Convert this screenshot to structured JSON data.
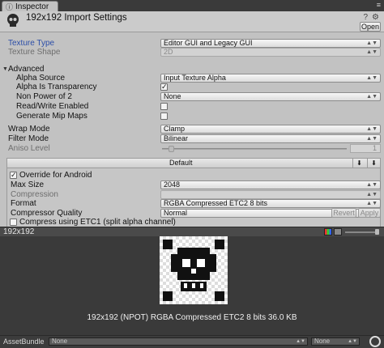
{
  "window": {
    "tab_label": "Inspector",
    "title": "192x192 Import Settings",
    "open_button": "Open"
  },
  "properties": {
    "texture_type_label": "Texture Type",
    "texture_type_value": "Editor GUI and Legacy GUI",
    "texture_shape_label": "Texture Shape",
    "texture_shape_value": "2D",
    "advanced_label": "Advanced",
    "alpha_source_label": "Alpha Source",
    "alpha_source_value": "Input Texture Alpha",
    "alpha_transparency_label": "Alpha Is Transparency",
    "alpha_transparency_checked": "✓",
    "non_power2_label": "Non Power of 2",
    "non_power2_value": "None",
    "read_write_label": "Read/Write Enabled",
    "mipmaps_label": "Generate Mip Maps",
    "wrap_mode_label": "Wrap Mode",
    "wrap_mode_value": "Clamp",
    "filter_mode_label": "Filter Mode",
    "filter_mode_value": "Bilinear",
    "aniso_label": "Aniso Level",
    "aniso_value": "1"
  },
  "platform": {
    "header_label": "Default",
    "override_label": "Override for Android",
    "override_checked": "✓",
    "max_size_label": "Max Size",
    "max_size_value": "2048",
    "compression_label": "Compression",
    "compression_value": "",
    "format_label": "Format",
    "format_value": "RGBA Compressed ETC2 8 bits",
    "compressor_quality_label": "Compressor Quality",
    "compressor_quality_value": "Normal",
    "etc1_label": "Compress using ETC1 (split alpha channel)"
  },
  "actions": {
    "revert_label": "Revert",
    "apply_label": "Apply"
  },
  "preview": {
    "title": "192x192",
    "info": "192x192 (NPOT)  RGBA Compressed ETC2 8 bits   36.0 KB"
  },
  "asset_bundle": {
    "label": "AssetBundle",
    "bundle_value": "None",
    "variant_value": "None"
  }
}
